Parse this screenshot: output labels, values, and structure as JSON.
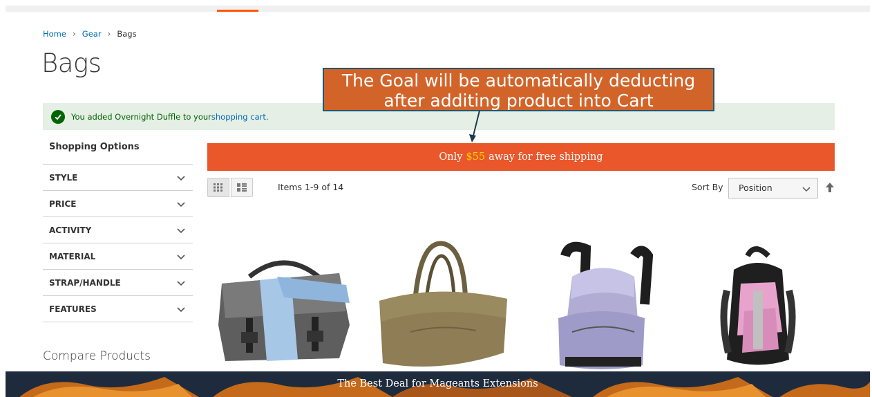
{
  "breadcrumb": {
    "home": "Home",
    "gear": "Gear",
    "current": "Bags",
    "separator": "›"
  },
  "page": {
    "title": "Bags"
  },
  "annotation": {
    "line1": "The Goal will be automatically deducting",
    "line2": "after additing product into Cart"
  },
  "message": {
    "prefix": "You added Overnight Duffle to your ",
    "link": "shopping cart",
    "suffix": "."
  },
  "sidebar": {
    "title": "Shopping Options",
    "filters": [
      {
        "label": "STYLE"
      },
      {
        "label": "PRICE"
      },
      {
        "label": "ACTIVITY"
      },
      {
        "label": "MATERIAL"
      },
      {
        "label": "STRAP/HANDLE"
      },
      {
        "label": "FEATURES"
      }
    ],
    "compare_title": "Compare Products"
  },
  "shipping": {
    "prefix": "Only",
    "amount": "$55",
    "suffix": "away for free shipping"
  },
  "toolbar": {
    "items_count": "Items 1-9 of 14",
    "sort_label": "Sort By",
    "sort_value": "Position"
  },
  "banner": {
    "text": "The Best Deal for Mageants Extensions"
  },
  "colors": {
    "accent": "#ff5501",
    "shipbar": "#e9572b",
    "callout": "#d2642a",
    "link": "#006bb4",
    "success_bg": "#e5efe5"
  }
}
